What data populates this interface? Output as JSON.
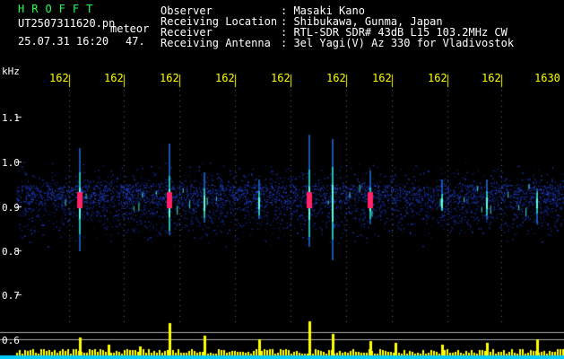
{
  "header": {
    "brand": "HROFFT",
    "filename": "UT2507311620.pn",
    "type_label": "meteor",
    "datetime": "25.07.31 16:20",
    "count": "47.",
    "info": [
      {
        "label": "Observer",
        "value": ": Masaki Kano"
      },
      {
        "label": "Receiving Location",
        "value": ": Shibukawa, Gunma, Japan"
      },
      {
        "label": "Receiver",
        "value": ": RTL-SDR SDR# 43dB L15 103.2MHz CW"
      },
      {
        "label": "Receiving Antenna",
        "value": ": 3el Yagi(V) Az 330 for Vladivostok"
      }
    ]
  },
  "axis": {
    "unit": "kHz",
    "y_ticks": [
      "1.1",
      "1.0",
      "0.9",
      "0.8",
      "0.7",
      "0.6"
    ],
    "time_ticks": [
      "162",
      "162",
      "162",
      "162",
      "162",
      "162",
      "162",
      "162",
      "162",
      "1630"
    ]
  },
  "colors": {
    "background": "#000000",
    "noise": "#1a2a9a",
    "echo": "#33ffcc",
    "hot": "#ff2266",
    "histogram": "#ffff00",
    "baseline": "#00ccff",
    "grid": "#ffffff"
  }
}
